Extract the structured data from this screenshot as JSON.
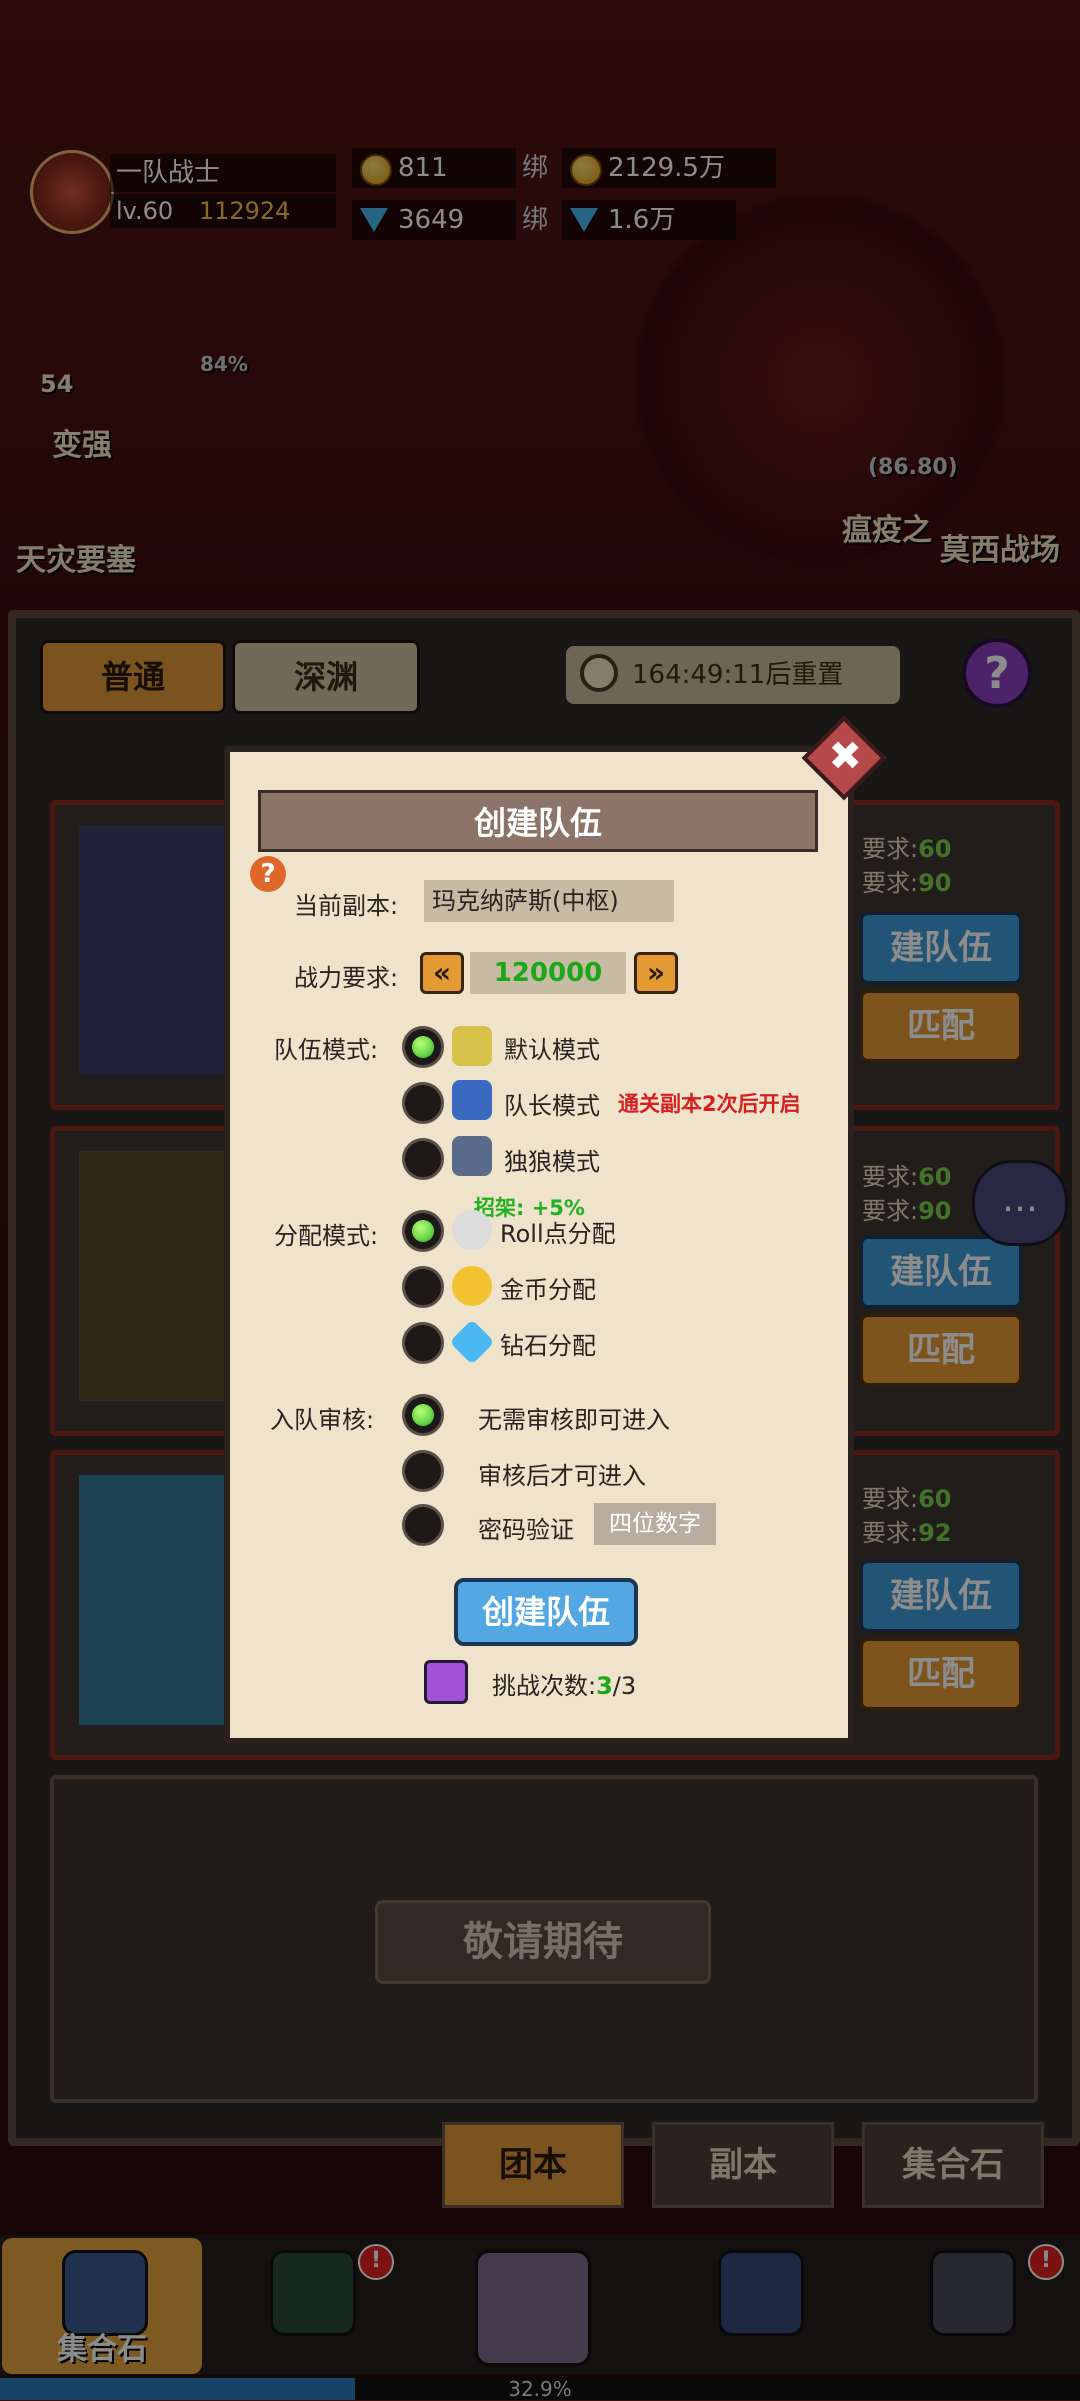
{
  "hud": {
    "player_name": "一队战士",
    "level": "lv.60",
    "power": "112924",
    "gold": "811",
    "bound_gold": "2129.5万",
    "diamonds": "3649",
    "bound_diamonds": "1.6万",
    "bound_prefix": "绑"
  },
  "background": {
    "left_label_1": "变强",
    "left_label_2": "天灾要塞",
    "left_level": "54",
    "left_pct": "84%",
    "right_label_1": "瘟疫之",
    "right_label_2": "莫西战场",
    "right_coords": "(86.80)"
  },
  "tabs": {
    "normal": "普通",
    "abyss": "深渊",
    "timer": "164:49:11后重置",
    "help": "?"
  },
  "cards": [
    {
      "req1_label": "要求:",
      "req1_val": "60",
      "req2_label": "要求:",
      "req2_val": "90",
      "create": "建队伍",
      "match": "匹配"
    },
    {
      "req1_label": "要求:",
      "req1_val": "60",
      "req2_label": "要求:",
      "req2_val": "90",
      "create": "建队伍",
      "match": "匹配"
    },
    {
      "req1_label": "要求:",
      "req1_val": "60",
      "req2_label": "要求:",
      "req2_val": "92",
      "create": "建队伍",
      "match": "匹配"
    }
  ],
  "coming_soon": "敬请期待",
  "sub_tabs": [
    "团本",
    "副本",
    "集合石"
  ],
  "bottom_nav": {
    "active_label": "集合石"
  },
  "progress": {
    "value": 0.329,
    "label": "32.9%"
  },
  "dialog": {
    "title": "创建队伍",
    "close": "✖",
    "help_icon": "?",
    "current_dungeon_label": "当前副本:",
    "current_dungeon_value": "玛克纳萨斯(中枢)",
    "power_label": "战力要求:",
    "power_value": "120000",
    "prev_arrow": "«",
    "next_arrow": "»",
    "team_mode_label": "队伍模式:",
    "team_modes": [
      {
        "label": "默认模式",
        "selected": true
      },
      {
        "label": "队长模式",
        "selected": false,
        "note": "通关副本2次后开启"
      },
      {
        "label": "独狼模式",
        "selected": false
      }
    ],
    "dist_bonus": "招架: +5%",
    "distribution_label": "分配模式:",
    "distribution_modes": [
      {
        "label": "Roll点分配",
        "selected": true
      },
      {
        "label": "金币分配",
        "selected": false
      },
      {
        "label": "钻石分配",
        "selected": false
      }
    ],
    "review_label": "入队审核:",
    "review_modes": [
      {
        "label": "无需审核即可进入",
        "selected": true
      },
      {
        "label": "审核后才可进入",
        "selected": false
      },
      {
        "label": "密码验证",
        "selected": false
      }
    ],
    "password_placeholder": "四位数字",
    "create_button": "创建队伍",
    "challenge_label": "挑战次数:",
    "challenge_current": "3",
    "challenge_total": "/3"
  },
  "colors": {
    "accent_orange": "#e49a33",
    "accent_blue": "#53a7e3",
    "selected_green": "#2fb81f",
    "warning_red": "#d61f1f"
  }
}
